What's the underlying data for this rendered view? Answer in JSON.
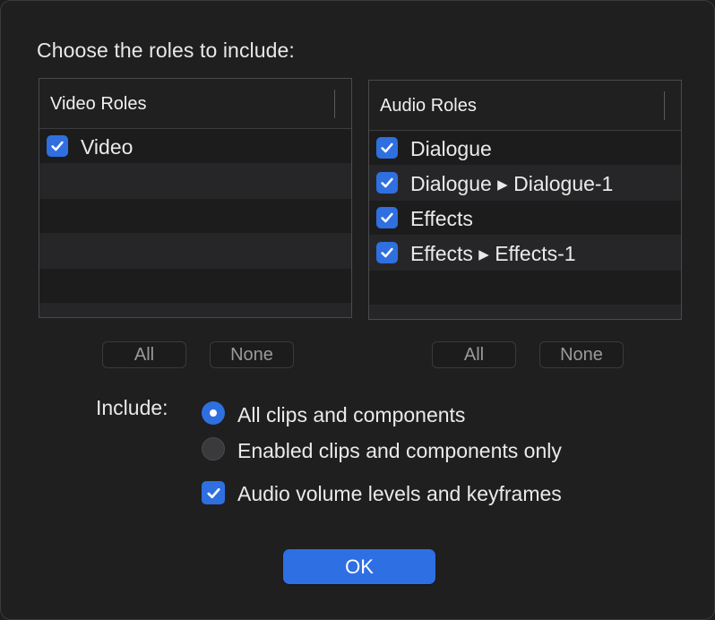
{
  "prompt": "Choose the roles to include:",
  "video_table": {
    "header": "Video Roles",
    "rows": [
      {
        "label": "Video",
        "checked": true
      }
    ]
  },
  "audio_table": {
    "header": "Audio Roles",
    "rows": [
      {
        "label": "Dialogue",
        "checked": true
      },
      {
        "label": "Dialogue ▸ Dialogue-1",
        "checked": true
      },
      {
        "label": "Effects",
        "checked": true
      },
      {
        "label": "Effects ▸ Effects-1",
        "checked": true
      }
    ]
  },
  "video_buttons": {
    "all": "All",
    "none": "None"
  },
  "audio_buttons": {
    "all": "All",
    "none": "None"
  },
  "include": {
    "label": "Include:",
    "options": [
      {
        "label": "All clips and components",
        "selected": true
      },
      {
        "label": "Enabled clips and components only",
        "selected": false
      }
    ],
    "checkbox": {
      "label": "Audio volume levels and keyframes",
      "checked": true
    }
  },
  "ok_label": "OK",
  "colors": {
    "accent": "#2f6fe0",
    "background": "#1f1f20"
  }
}
